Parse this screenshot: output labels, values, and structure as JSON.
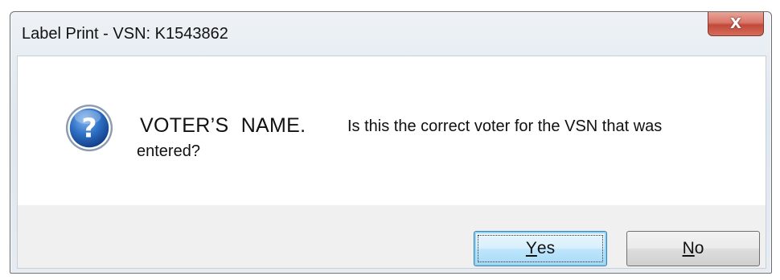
{
  "window": {
    "title": "Label Print - VSN: K1543862",
    "close_glyph": "X"
  },
  "dialog": {
    "icon": "question-icon",
    "voter_name": "VOTER’S NAME.",
    "message_line1": "Is this the correct voter for the VSN that was",
    "message_line2": "entered?"
  },
  "buttons": {
    "yes_mnemonic": "Y",
    "yes_rest": "es",
    "no_mnemonic": "N",
    "no_rest": "o"
  },
  "colors": {
    "close_button": "#d9776a",
    "default_button_border": "#3c7fb1",
    "icon_blue": "#1e5fb3"
  }
}
